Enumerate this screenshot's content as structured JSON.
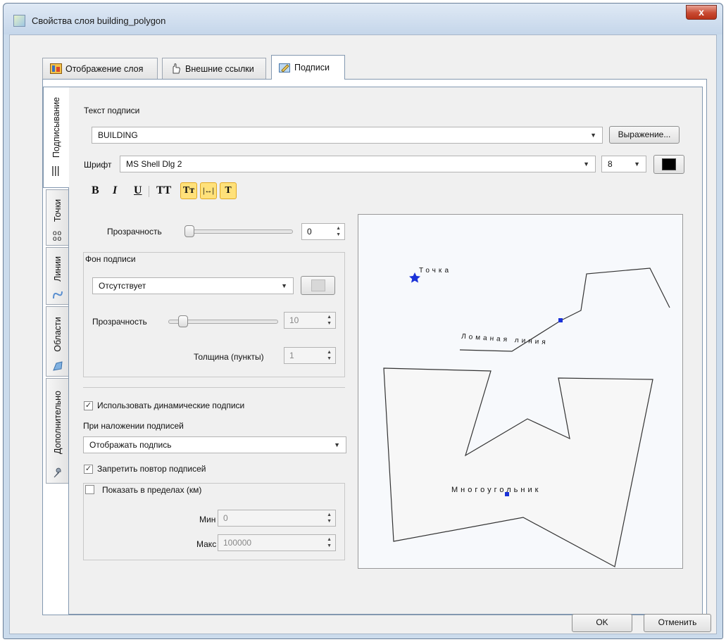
{
  "window": {
    "title": "Свойства слоя building_polygon",
    "close_label": "x"
  },
  "tabs": [
    {
      "label": "Отображение слоя",
      "icon": "layer-display-icon"
    },
    {
      "label": "Внешние ссылки",
      "icon": "hand-link-icon"
    },
    {
      "label": "Подписи",
      "icon": "labels-icon",
      "active": true
    }
  ],
  "side_tabs": [
    {
      "label": "Подписывание",
      "icon": "label-lines-icon",
      "active": true
    },
    {
      "label": "Точки",
      "icon": "points-icon"
    },
    {
      "label": "Линии",
      "icon": "line-icon"
    },
    {
      "label": "Области",
      "icon": "area-icon"
    },
    {
      "label": "Дополнительно",
      "icon": "wrench-icon"
    }
  ],
  "label_text": {
    "heading": "Текст подписи",
    "value": "BUILDING",
    "expression_button": "Выражение..."
  },
  "font": {
    "label": "Шрифт",
    "value": "MS Shell Dlg 2",
    "size": "8",
    "color": "#000000"
  },
  "format_buttons": {
    "bold": "B",
    "italic": "I",
    "underline": "U",
    "caps": "TT",
    "small_caps": "Tт",
    "spacing": "|↔|",
    "outline": "T"
  },
  "transparency": {
    "label": "Прозрачность",
    "value": "0"
  },
  "background": {
    "group_title": "Фон подписи",
    "type": "Отсутствует",
    "color": "#d8d8d8",
    "transparency_label": "Прозрачность",
    "transparency_value": "10",
    "thickness_label": "Толщина (пункты)",
    "thickness_value": "1"
  },
  "dynamic_labels": {
    "label": "Использовать динамические подписи",
    "checked": true
  },
  "overlap": {
    "label": "При наложении подписей",
    "value": "Отображать подпись"
  },
  "no_repeat": {
    "label": "Запретить повтор подписей",
    "checked": true
  },
  "range": {
    "label": "Показать в пределах (км)",
    "checked": false,
    "min_label": "Мин",
    "min_value": "0",
    "max_label": "Макс",
    "max_value": "100000"
  },
  "preview": {
    "point_label": "Точка",
    "line_label": "Ломаная линия",
    "polygon_label": "Многоугольник"
  },
  "footer": {
    "ok": "OK",
    "cancel": "Отменить"
  }
}
